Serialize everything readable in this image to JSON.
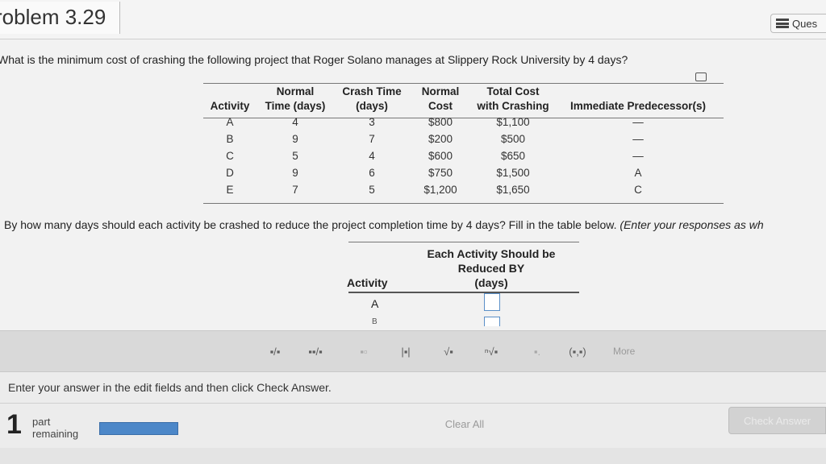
{
  "header": {
    "title": "roblem 3.29",
    "questions_button": "Ques",
    "questions_icon": "list-icon"
  },
  "question": {
    "text": "What is the minimum cost of crashing the following project that Roger Solano manages at Slippery Rock University by 4 days?",
    "copy_icon": "copy-icon"
  },
  "project_table": {
    "headers": {
      "activity": [
        "",
        "Activity"
      ],
      "normal_time": [
        "Normal",
        "Time (days)"
      ],
      "crash_time": [
        "Crash Time",
        "(days)"
      ],
      "normal_cost": [
        "Normal",
        "Cost"
      ],
      "total_cost": [
        "Total Cost",
        "with Crashing"
      ],
      "predecessors": [
        "",
        "Immediate Predecessor(s)"
      ]
    },
    "rows": [
      {
        "activity": "A",
        "normal_time": "4",
        "crash_time": "3",
        "normal_cost": "$800",
        "total_cost": "$1,100",
        "predecessors": "—"
      },
      {
        "activity": "B",
        "normal_time": "9",
        "crash_time": "7",
        "normal_cost": "$200",
        "total_cost": "$500",
        "predecessors": "—"
      },
      {
        "activity": "C",
        "normal_time": "5",
        "crash_time": "4",
        "normal_cost": "$600",
        "total_cost": "$650",
        "predecessors": "—"
      },
      {
        "activity": "D",
        "normal_time": "9",
        "crash_time": "6",
        "normal_cost": "$750",
        "total_cost": "$1,500",
        "predecessors": "A"
      },
      {
        "activity": "E",
        "normal_time": "7",
        "crash_time": "5",
        "normal_cost": "$1,200",
        "total_cost": "$1,650",
        "predecessors": "C"
      }
    ]
  },
  "sub_question": {
    "text": "By how many days should each activity be crashed to reduce the project completion time by 4 days? Fill in the table below.",
    "italic": "(Enter your responses as wh"
  },
  "answer_table": {
    "header_reduce": [
      "Each Activity Should be",
      "Reduced BY",
      "(days)"
    ],
    "header_activity": "Activity",
    "rows": [
      {
        "activity": "A",
        "value": ""
      },
      {
        "activity": "B",
        "value": ""
      }
    ]
  },
  "toolbar": {
    "tools": [
      {
        "name": "fraction-tool",
        "glyph": "▪/▪"
      },
      {
        "name": "mixed-number-tool",
        "glyph": "▪▪/▪"
      },
      {
        "name": "exponent-tool",
        "glyph": "▪▫"
      },
      {
        "name": "absolute-value-tool",
        "glyph": "|▪|"
      },
      {
        "name": "square-root-tool",
        "glyph": "√▪"
      },
      {
        "name": "nth-root-tool",
        "glyph": "ⁿ√▪"
      },
      {
        "name": "decimal-tool",
        "glyph": "▪."
      },
      {
        "name": "ordered-pair-tool",
        "glyph": "(▪,▪)"
      },
      {
        "name": "more-tool",
        "glyph": "More"
      }
    ]
  },
  "footer": {
    "instruction": "Enter your answer in the edit fields and then click Check Answer.",
    "part_number": "1",
    "part_label_1": "part",
    "part_label_2": "remaining",
    "clear_all": "Clear All",
    "check_answer": "Check Answer"
  }
}
